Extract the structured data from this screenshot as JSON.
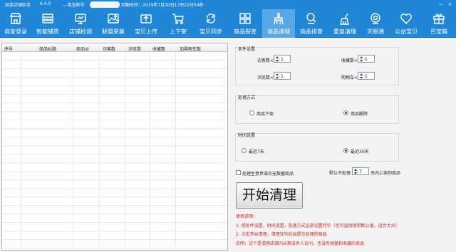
{
  "titlebar": {
    "app_name": "商芽店铺助手",
    "version": "6.4.0",
    "account_label": "---淘宝帐号",
    "expiry": "到期时间：2019年7月30日17时22分54秒",
    "minimize": "—",
    "close": "✕"
  },
  "toolbar": [
    {
      "label": "商家登录",
      "icon": "shop-icon"
    },
    {
      "label": "智能铺货",
      "icon": "goods-icon"
    },
    {
      "label": "店铺检测",
      "icon": "monitor-icon"
    },
    {
      "label": "联盟采集",
      "icon": "image-icon"
    },
    {
      "label": "宝贝上传",
      "icon": "upload-icon"
    },
    {
      "label": "上下架",
      "icon": "cart-icon"
    },
    {
      "label": "宝贝同步",
      "icon": "sync-icon"
    },
    {
      "label": "商品裂变",
      "icon": "grid-icon"
    },
    {
      "label": "商品清理",
      "icon": "broom-icon"
    },
    {
      "label": "商品排查",
      "icon": "search-icon"
    },
    {
      "label": "重复清理",
      "icon": "clean-icon"
    },
    {
      "label": "天眼通",
      "icon": "camera-icon"
    },
    {
      "label": "公益宝贝",
      "icon": "heart-icon"
    },
    {
      "label": "百宝箱",
      "icon": "gift-icon"
    }
  ],
  "active_tab": "商品清理",
  "grid": {
    "columns": [
      "序号",
      "商品标题",
      "商品id",
      "访客数",
      "浏览数",
      "收藏数",
      "加购物车数"
    ],
    "rows": []
  },
  "conditions": {
    "title": "条件设置",
    "visitors_label": "访客数<",
    "visitors_value": "1",
    "favorites_label": "收藏数<",
    "favorites_value": "1",
    "views_label": "浏览数<",
    "views_value": "1",
    "cart_label": "购物车<",
    "cart_value": "1"
  },
  "method": {
    "title": "处理方式",
    "option_delist": "商品下架",
    "option_delete": "商品删除",
    "selected": "商品删除"
  },
  "time": {
    "title": "时间设置",
    "option_7": "最近7天",
    "option_30": "最近30天",
    "selected": "最近30天"
  },
  "extra": {
    "checkbox_label": "处理生意参谋中无数据商品",
    "checked": false,
    "listed_prefix": "默认不处理",
    "listed_days": "7",
    "listed_suffix": "天内上架的商品"
  },
  "start_button": "开始清理",
  "notes": {
    "title": "使用说明：",
    "line1": "1. 把条件设置，时间设置，处理方式全部设置完毕（也可直接使用默认值，适合大众）",
    "line2": "2. 点击开始清理，清理完毕后会提示处理的商品",
    "line3": "说明：这个是清理店铺内长期没有人访问，也没有销量和收藏的商品"
  }
}
